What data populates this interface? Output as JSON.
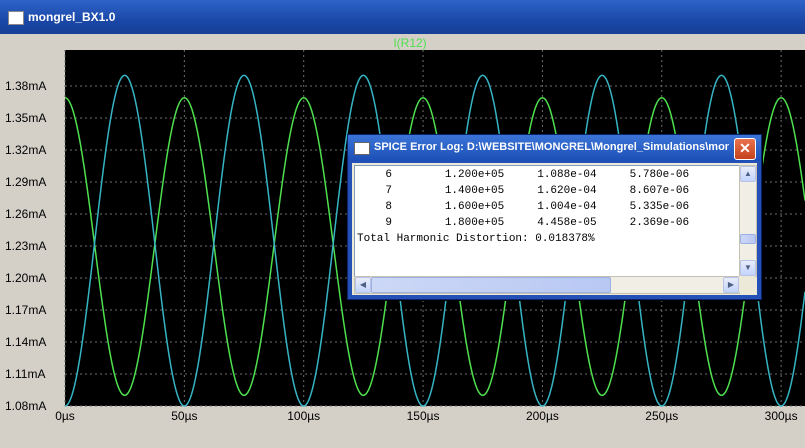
{
  "window": {
    "title": "mongrel_BX1.0",
    "icon": "waveform-app-icon"
  },
  "plot": {
    "trace_label": "I(R12)",
    "colors": {
      "background": "#000000",
      "grid": "#6e6e6e",
      "green": "#4ee04e",
      "cyan": "#36b4c4",
      "text": "#000000",
      "trace_label": "#4ee04e"
    }
  },
  "chart_data": {
    "type": "line",
    "title": "I(R12)",
    "xlabel": "",
    "ylabel": "",
    "xlim": [
      0,
      310
    ],
    "ylim": [
      1.08,
      1.39
    ],
    "x_unit": "µs",
    "y_unit": "mA",
    "x_ticks": [
      "0µs",
      "50µs",
      "100µs",
      "150µs",
      "200µs",
      "250µs",
      "300µs"
    ],
    "y_ticks": [
      "1.08mA",
      "1.11mA",
      "1.14mA",
      "1.17mA",
      "1.20mA",
      "1.23mA",
      "1.26mA",
      "1.29mA",
      "1.32mA",
      "1.35mA",
      "1.38mA"
    ],
    "grid": true,
    "series": [
      {
        "color": "#4ee04e",
        "offset": 1.2295,
        "amplitude": 0.1395,
        "period_us": 50,
        "phase_deg": 90
      },
      {
        "color": "#36b4c4",
        "offset": 1.235,
        "amplitude": 0.155,
        "period_us": 50,
        "phase_deg": -90
      }
    ]
  },
  "error_log": {
    "title": "SPICE Error Log: D:\\WEBSITE\\MONGREL\\Mongrel_Simulations\\mon...",
    "close_label": "✕",
    "rows": [
      {
        "n": "6",
        "freq": "1.200e+05",
        "comp": "1.088e-04",
        "norm": "5.780e-06"
      },
      {
        "n": "7",
        "freq": "1.400e+05",
        "comp": "1.620e-04",
        "norm": "8.607e-06"
      },
      {
        "n": "8",
        "freq": "1.600e+05",
        "comp": "1.004e-04",
        "norm": "5.335e-06"
      },
      {
        "n": "9",
        "freq": "1.800e+05",
        "comp": "4.458e-05",
        "norm": "2.369e-06"
      }
    ],
    "thd_line": "Total Harmonic Distortion: 0.018378%"
  }
}
